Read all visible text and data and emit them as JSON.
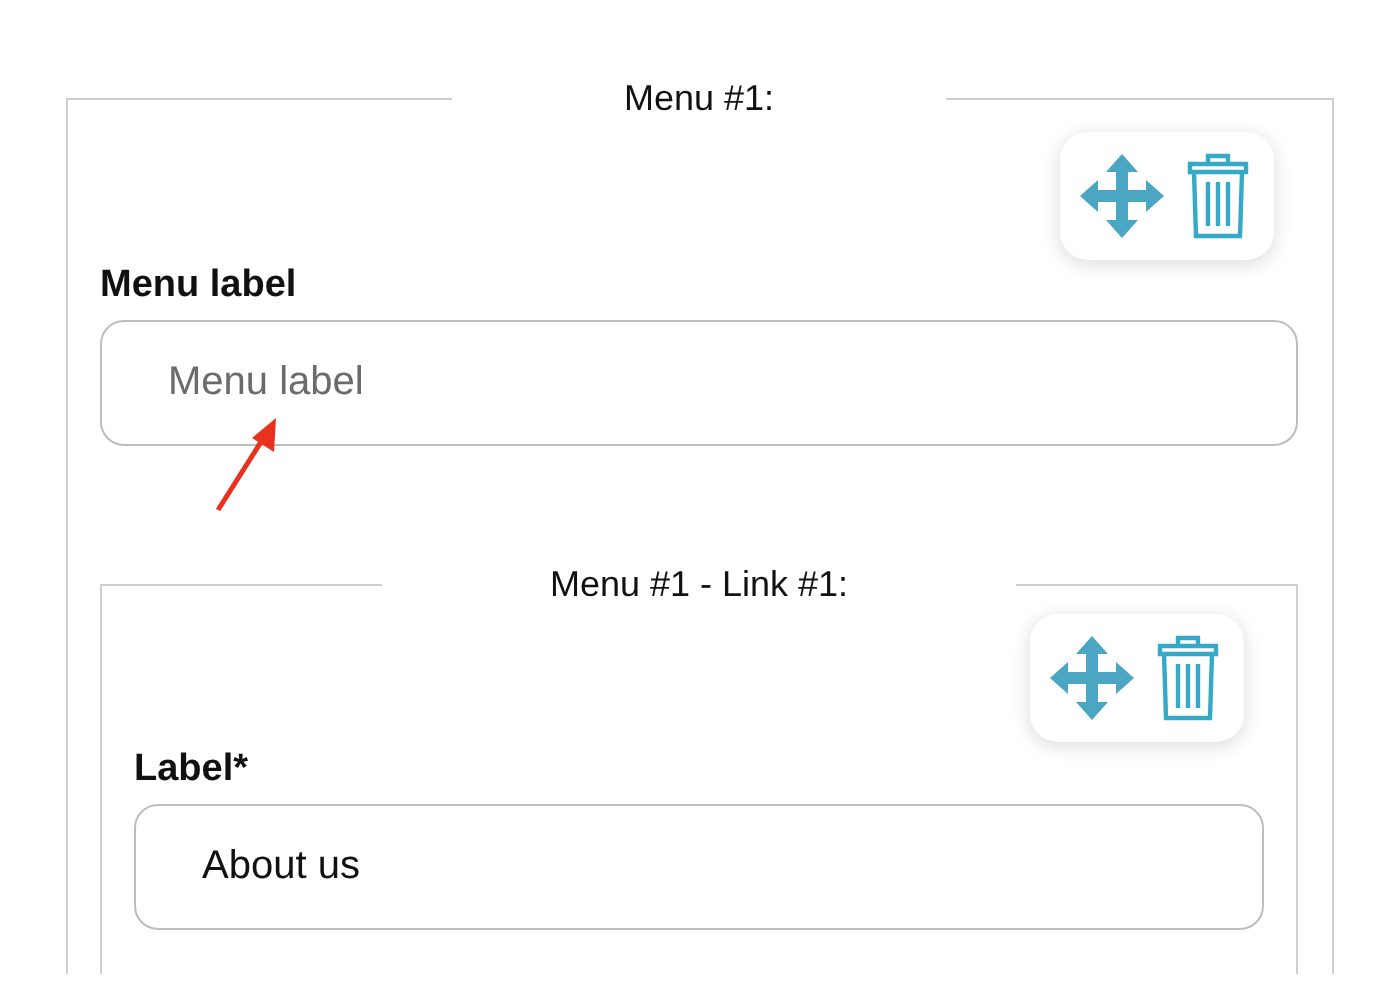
{
  "menus": [
    {
      "legend": "Menu #1:",
      "label_field": {
        "label": "Menu label",
        "placeholder": "Menu label"
      },
      "links": [
        {
          "legend": "Menu #1 - Link #1:",
          "label_field": {
            "label": "Label*",
            "value": "About us"
          }
        }
      ]
    }
  ]
}
